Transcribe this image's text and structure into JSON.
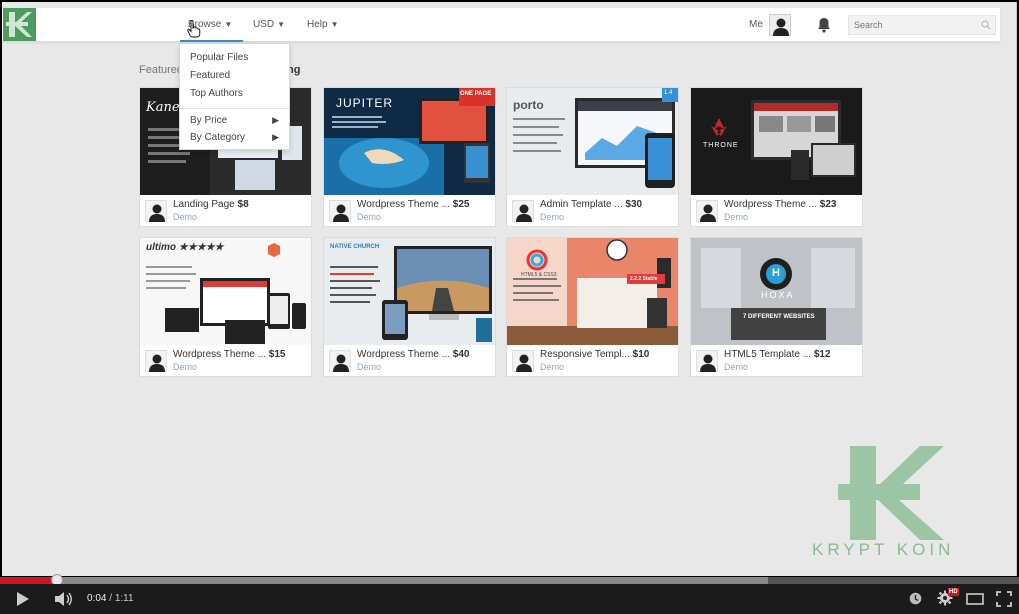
{
  "navbar": {
    "menus": [
      {
        "label": "Browse"
      },
      {
        "label": "USD"
      },
      {
        "label": "Help"
      }
    ],
    "me_label": "Me",
    "search_placeholder": "Search",
    "accent_color": "#3c8dbc",
    "logo_color": "#4e9b5e"
  },
  "browse_dropdown": {
    "items": [
      {
        "label": "Popular Files",
        "submenu": false
      },
      {
        "label": "Featured",
        "submenu": false
      },
      {
        "label": "Top Authors",
        "submenu": false
      },
      {
        "label": "By Price",
        "submenu": true
      },
      {
        "label": "By Category",
        "submenu": true
      }
    ]
  },
  "section": {
    "title_visible_start": "Featured",
    "title_visible_end": "ng"
  },
  "products": [
    {
      "title": "Landing Page",
      "price": "$8",
      "link": "Demo",
      "thumb_banner": "Kane"
    },
    {
      "title": "Wordpress Theme ...",
      "price": "$25",
      "link": "Demo",
      "thumb_banner": "JUPITER",
      "thumb_ribbon": "ONE PAGE"
    },
    {
      "title": "Admin Template ...",
      "price": "$30",
      "link": "Demo",
      "thumb_banner": "porto",
      "thumb_ribbon": "1.4"
    },
    {
      "title": "Wordpress Theme ...",
      "price": "$23",
      "link": "Demo",
      "thumb_banner": "THRONE"
    },
    {
      "title": "Wordpress Theme ...",
      "price": "$15",
      "link": "Demo",
      "thumb_banner": "ultimo ★★★★★"
    },
    {
      "title": "Wordpress Theme ...",
      "price": "$40",
      "link": "Demo",
      "thumb_banner": "NATIVE CHURCH"
    },
    {
      "title": "Responsive Templ...",
      "price": "$10",
      "link": "Demo",
      "thumb_banner": "HTML5 & CSS3",
      "thumb_ribbon": "2.2.2 Stable"
    },
    {
      "title": "HTML5 Template ...",
      "price": "$12",
      "link": "Demo",
      "thumb_banner": "HOXA",
      "thumb_ribbon": "7 DIFFERENT WEBSITES"
    }
  ],
  "watermark": {
    "text": "KRYPT KOIN",
    "color": "#7bb386"
  },
  "player": {
    "time_current": "0:04",
    "time_total": "1:11",
    "time_separator": "/",
    "played_fraction": 0.056,
    "buffered_fraction": 0.754,
    "hd_badge": "HD",
    "played_color": "#cc181e"
  }
}
